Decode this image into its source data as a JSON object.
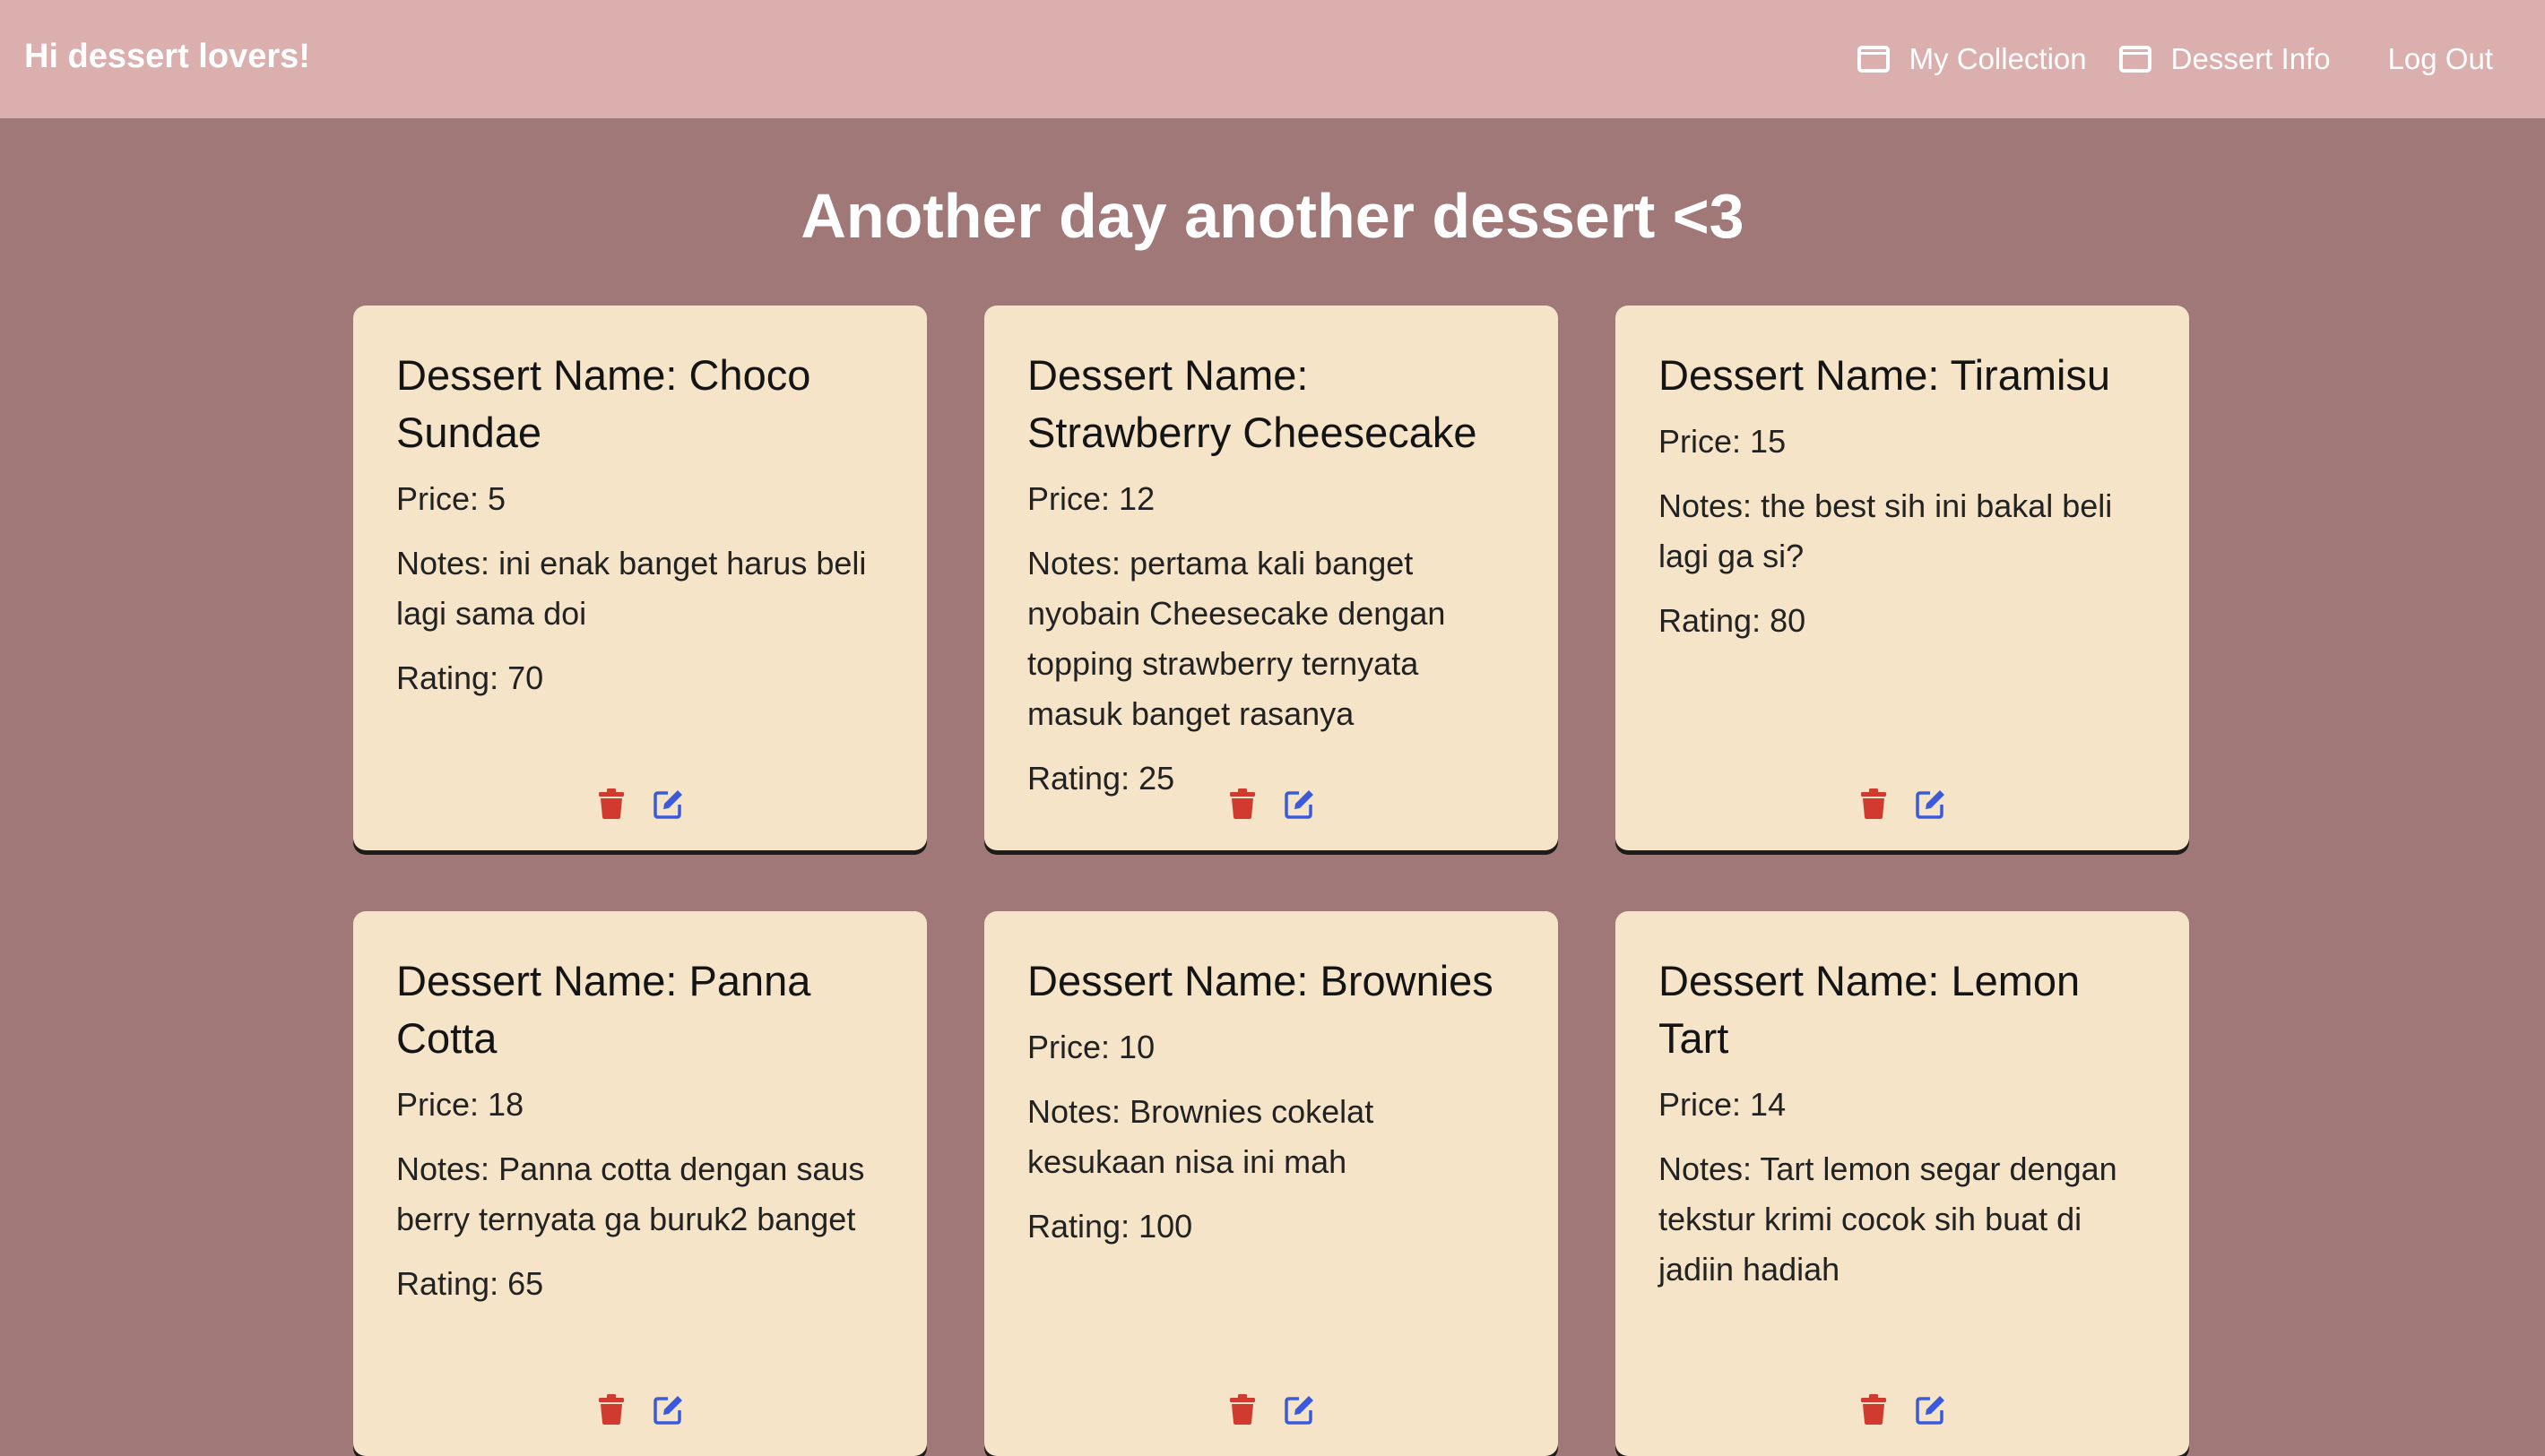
{
  "navbar": {
    "brand": "Hi dessert lovers!",
    "links": [
      {
        "label": "My Collection",
        "icon": "window-icon"
      },
      {
        "label": "Dessert Info",
        "icon": "window-icon"
      },
      {
        "label": "Log Out"
      }
    ],
    "background": "#dcafaf"
  },
  "page": {
    "heading": "Another day another dessert <3",
    "background": "#a07877"
  },
  "labels": {
    "name": "Dessert Name:",
    "price": "Price:",
    "notes": "Notes:",
    "rating": "Rating:"
  },
  "cards": [
    {
      "name": "Choco Sundae",
      "price": "5",
      "notes": "ini enak banget harus beli lagi sama doi",
      "rating": "70"
    },
    {
      "name": "Strawberry Cheesecake",
      "price": "12",
      "notes": "pertama kali banget nyobain Cheesecake dengan topping strawberry ternyata masuk banget rasanya",
      "rating": "25"
    },
    {
      "name": "Tiramisu",
      "price": "15",
      "notes": "the best sih ini bakal beli lagi ga si?",
      "rating": "80"
    },
    {
      "name": "Panna Cotta",
      "price": "18",
      "notes": "Panna cotta dengan saus berry ternyata ga buruk2 banget",
      "rating": "65"
    },
    {
      "name": "Brownies",
      "price": "10",
      "notes": "Brownies cokelat kesukaan nisa ini mah",
      "rating": "100"
    },
    {
      "name": "Lemon Tart",
      "price": "14",
      "notes": "Tart lemon segar dengan tekstur krimi cocok sih buat di jadiin hadiah",
      "rating": ""
    }
  ],
  "colors": {
    "card": "#f5e4c8",
    "delete_icon": "#d13a2e",
    "edit_icon": "#3a5bd9"
  }
}
